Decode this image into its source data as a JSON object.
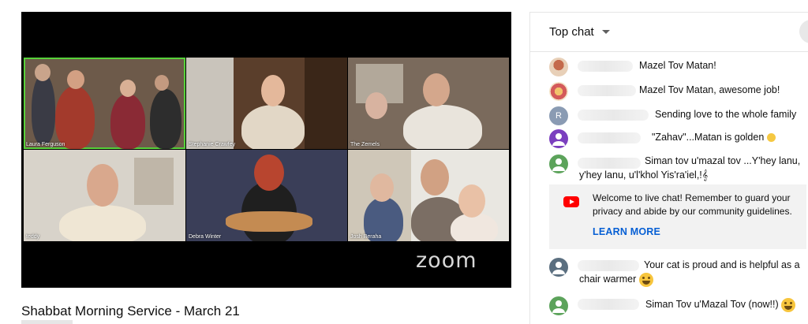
{
  "player": {
    "participants": [
      {
        "name": "Laura Ferguson"
      },
      {
        "name": "Stephanie Crawfey"
      },
      {
        "name": "The Zemels"
      },
      {
        "name": "teddy"
      },
      {
        "name": "Debra Winter"
      },
      {
        "name": "Josh Beraha"
      }
    ],
    "logo_text": "zoom"
  },
  "video": {
    "title": "Shabbat Morning Service - March 21"
  },
  "chat": {
    "header_label": "Top chat",
    "messages": [
      {
        "avatar_icon": "photo-avatar",
        "text": "Mazel Tov Matan!"
      },
      {
        "avatar_icon": "photo-avatar",
        "text": "Mazel Tov Matan, awesome job!"
      },
      {
        "avatar_letter": "R",
        "avatar_color": "#8a9bb3",
        "text": "Sending love to the whole family"
      },
      {
        "avatar_icon": "person-avatar",
        "avatar_color": "#7b3fbf",
        "text": "\"Zahav\"...Matan is golden"
      },
      {
        "avatar_icon": "person-avatar",
        "avatar_color": "#5ca35b",
        "text": "Siman tov u'mazal tov ...Y'hey lanu,",
        "text2": "y'hey lanu, u'l'khol Yis'ra'iel,!𝄞"
      },
      {
        "avatar_icon": "person-avatar",
        "avatar_color": "#5b6f80",
        "text": "Your cat is proud and is helpful as a",
        "text2": "chair warmer"
      },
      {
        "avatar_icon": "person-avatar",
        "avatar_color": "#5ca35b",
        "text": "Siman Tov u'Mazal Tov (now!!)"
      }
    ],
    "welcome": {
      "text": "Welcome to live chat! Remember to guard your privacy and abide by our community guidelines.",
      "link": "LEARN MORE"
    }
  }
}
